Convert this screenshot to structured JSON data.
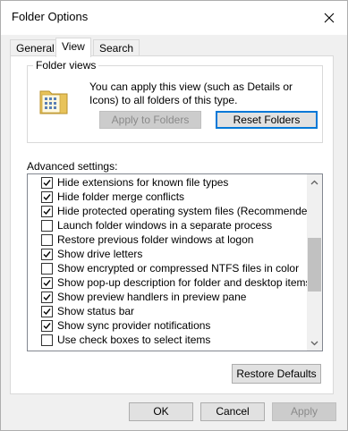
{
  "window": {
    "title": "Folder Options"
  },
  "tabs": [
    {
      "label": "General",
      "active": false
    },
    {
      "label": "View",
      "active": true
    },
    {
      "label": "Search",
      "active": false
    }
  ],
  "folder_views": {
    "title": "Folder views",
    "description": "You can apply this view (such as Details or Icons) to all folders of this type.",
    "apply_label": "Apply to Folders",
    "reset_label": "Reset Folders"
  },
  "advanced": {
    "label": "Advanced settings:",
    "items": [
      {
        "label": "Hide extensions for known file types",
        "checked": true
      },
      {
        "label": "Hide folder merge conflicts",
        "checked": true
      },
      {
        "label": "Hide protected operating system files (Recommended)",
        "checked": true
      },
      {
        "label": "Launch folder windows in a separate process",
        "checked": false
      },
      {
        "label": "Restore previous folder windows at logon",
        "checked": false
      },
      {
        "label": "Show drive letters",
        "checked": true
      },
      {
        "label": "Show encrypted or compressed NTFS files in color",
        "checked": false
      },
      {
        "label": "Show pop-up description for folder and desktop items",
        "checked": true
      },
      {
        "label": "Show preview handlers in preview pane",
        "checked": true
      },
      {
        "label": "Show status bar",
        "checked": true
      },
      {
        "label": "Show sync provider notifications",
        "checked": true
      },
      {
        "label": "Use check boxes to select items",
        "checked": false
      }
    ],
    "restore_label": "Restore Defaults"
  },
  "footer": {
    "ok_label": "OK",
    "cancel_label": "Cancel",
    "apply_label": "Apply"
  },
  "icons": {
    "close": "close-icon",
    "folder": "folder-view-icon",
    "check": "checkmark-icon"
  },
  "colors": {
    "accent": "#0078d7",
    "disabled_text": "#8a8a8a"
  }
}
